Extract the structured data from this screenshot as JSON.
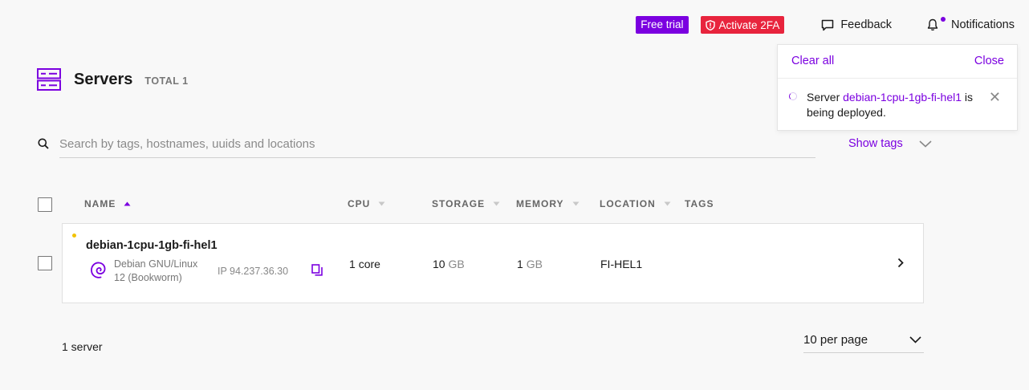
{
  "topbar": {
    "free_trial": "Free trial",
    "activate_2fa": "Activate 2FA",
    "feedback": "Feedback",
    "notifications": "Notifications"
  },
  "notification_panel": {
    "clear_all": "Clear all",
    "close": "Close",
    "items": [
      {
        "prefix": "Server ",
        "host": "debian-1cpu-1gb-fi-hel1",
        "suffix": " is being deployed."
      }
    ]
  },
  "page": {
    "title": "Servers",
    "total": "TOTAL 1"
  },
  "search": {
    "placeholder": "Search by tags, hostnames, uuids and locations",
    "show_tags": "Show tags"
  },
  "table": {
    "columns": {
      "name": "NAME",
      "cpu": "CPU",
      "storage": "STORAGE",
      "memory": "MEMORY",
      "location": "LOCATION",
      "tags": "TAGS"
    },
    "rows": [
      {
        "hostname": "debian-1cpu-1gb-fi-hel1",
        "os_name": "Debian GNU/Linux",
        "os_version": "12 (Bookworm)",
        "ip": "IP 94.237.36.30",
        "cpu_value": "1",
        "cpu_unit": "core",
        "storage_value": "10",
        "storage_unit": "GB",
        "memory_value": "1",
        "memory_unit": "GB",
        "location": "FI-HEL1",
        "status_color": "#f2c200"
      }
    ]
  },
  "footer": {
    "count": "1 server",
    "per_page": "10 per page"
  },
  "colors": {
    "accent": "#7b00e0",
    "danger": "#e8243d",
    "pending": "#f2c200"
  }
}
